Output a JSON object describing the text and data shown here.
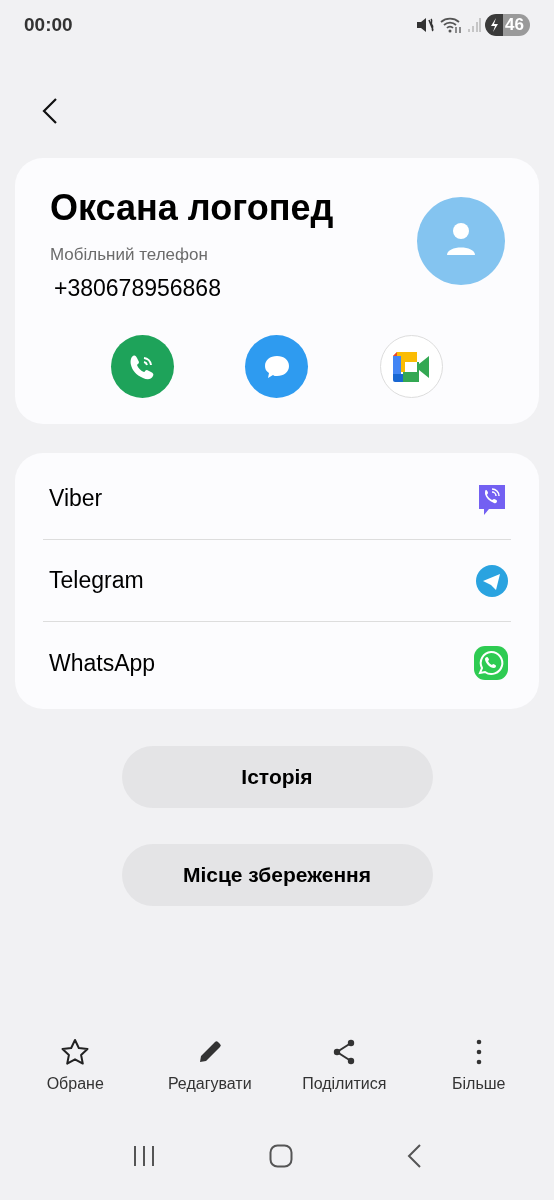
{
  "status_bar": {
    "time": "00:00",
    "battery": "46"
  },
  "contact": {
    "name": "Оксана логопед",
    "phone_label": "Мобільний телефон",
    "phone": "+380678956868"
  },
  "quick_actions": [
    {
      "kind": "call"
    },
    {
      "kind": "message"
    },
    {
      "kind": "video"
    }
  ],
  "apps": [
    {
      "label": "Viber",
      "kind": "viber"
    },
    {
      "label": "Telegram",
      "kind": "telegram"
    },
    {
      "label": "WhatsApp",
      "kind": "whatsapp"
    }
  ],
  "buttons": [
    "Історія",
    "Місце збереження"
  ],
  "toolbar": [
    {
      "label": "Обране",
      "kind": "star"
    },
    {
      "label": "Редагувати",
      "kind": "edit"
    },
    {
      "label": "Поділитися",
      "kind": "share"
    },
    {
      "label": "Більше",
      "kind": "more"
    }
  ]
}
